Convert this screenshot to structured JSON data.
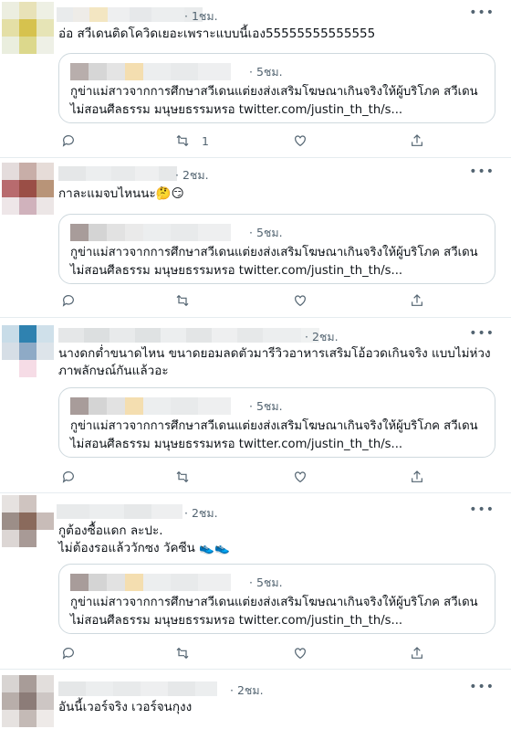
{
  "colors": {
    "text": "#0f1419",
    "muted": "#536471",
    "border": "#cfd9de",
    "divider": "#e6ecf0"
  },
  "quoted": {
    "time": "· 5ชม.",
    "text": "กูข่าแม่สาวจากการศึกษาสวีเดนแต่ยงส่งเสริมโฆษณาเกินจริงให้ผู้บริโภค สวีเดน\nไม่สอนศีลธรรม มนุษยธรรมหรอ twitter.com/justin_th_th/s..."
  },
  "tweets": [
    {
      "time": "· 1ชม.",
      "text": "อ่อ สวีเดนติดโควิดเยอะเพราะแบบนี้เอง55555555555555",
      "reply_count": "",
      "retweet_count": "1",
      "like_count": ""
    },
    {
      "time": "· 2ชม.",
      "text": "กาละแมจบไหนนะ🤔😏",
      "reply_count": "",
      "retweet_count": "",
      "like_count": ""
    },
    {
      "time": "· 2ชม.",
      "text": "นางดกต่ำขนาดไหน ขนาดยอมลดตัวมารีวิวอาหารเสริมโอ้อวดเกินจริง แบบไม่ห่วง\nภาพลักษณ์กันแล้วอะ",
      "reply_count": "",
      "retweet_count": "",
      "like_count": ""
    },
    {
      "time": "· 2ชม.",
      "text": "กูต้องซื้อแดก ละปะ.\nไม่ต้องรอแล้ววักซง วัคซีน 👟👟",
      "reply_count": "",
      "retweet_count": "",
      "like_count": ""
    },
    {
      "time": "· 2ชม.",
      "text": "อันนี้เวอร์จริง เวอร์จนกุงง"
    }
  ],
  "more_label": "•••"
}
